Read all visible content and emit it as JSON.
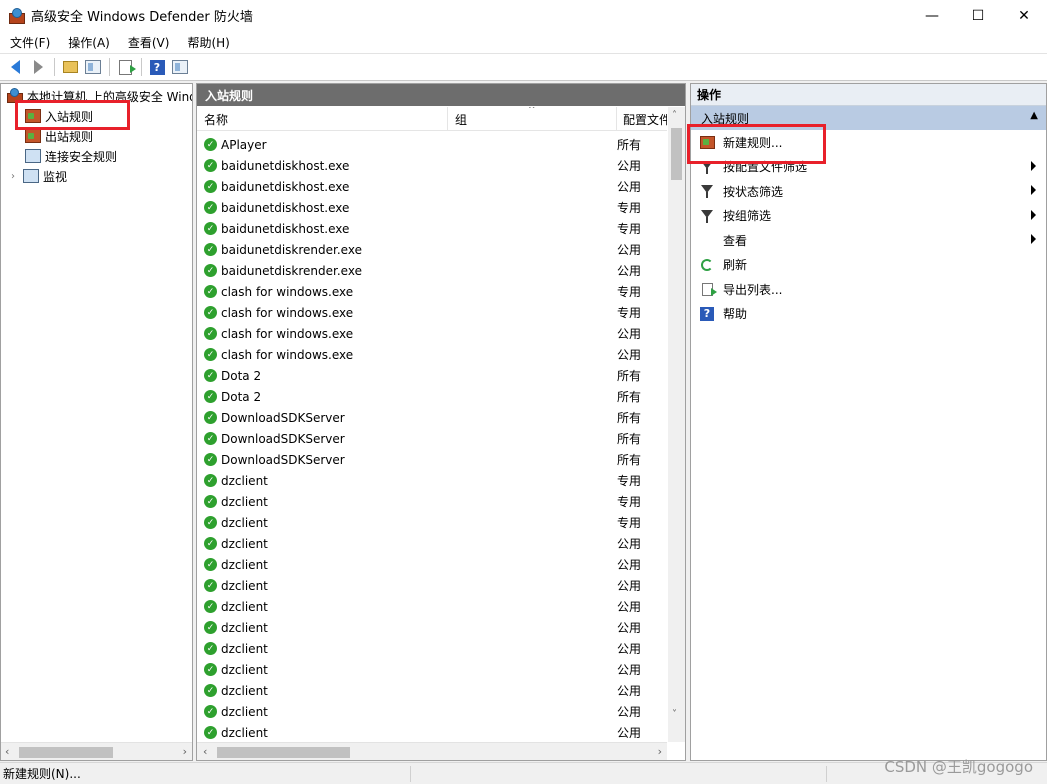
{
  "window": {
    "title": "高级安全 Windows Defender 防火墙",
    "minimize": "—",
    "maximize": "☐",
    "close": "✕"
  },
  "menu": [
    "文件(F)",
    "操作(A)",
    "查看(V)",
    "帮助(H)"
  ],
  "toolbar": {
    "icons": [
      "back-arrow-icon",
      "forward-arrow-icon",
      "up-folder-icon",
      "show-tree-icon",
      "export-icon",
      "help-icon",
      "show-action-pane-icon"
    ]
  },
  "tree": {
    "root": "本地计算机 上的高级安全 Windows Defender",
    "inbound": "入站规则",
    "outbound": "出站规则",
    "connection_security": "连接安全规则",
    "monitor": "监视"
  },
  "middle": {
    "header": "入站规则",
    "columns": {
      "name": "名称",
      "group": "组",
      "profile": "配置文件"
    },
    "rows": [
      {
        "name": "APlayer",
        "profile": "所有"
      },
      {
        "name": "baidunetdiskhost.exe",
        "profile": "公用"
      },
      {
        "name": "baidunetdiskhost.exe",
        "profile": "公用"
      },
      {
        "name": "baidunetdiskhost.exe",
        "profile": "专用"
      },
      {
        "name": "baidunetdiskhost.exe",
        "profile": "专用"
      },
      {
        "name": "baidunetdiskrender.exe",
        "profile": "公用"
      },
      {
        "name": "baidunetdiskrender.exe",
        "profile": "公用"
      },
      {
        "name": "clash for windows.exe",
        "profile": "专用"
      },
      {
        "name": "clash for windows.exe",
        "profile": "专用"
      },
      {
        "name": "clash for windows.exe",
        "profile": "公用"
      },
      {
        "name": "clash for windows.exe",
        "profile": "公用"
      },
      {
        "name": "Dota 2",
        "profile": "所有"
      },
      {
        "name": "Dota 2",
        "profile": "所有"
      },
      {
        "name": "DownloadSDKServer",
        "profile": "所有"
      },
      {
        "name": "DownloadSDKServer",
        "profile": "所有"
      },
      {
        "name": "DownloadSDKServer",
        "profile": "所有"
      },
      {
        "name": "dzclient",
        "profile": "专用"
      },
      {
        "name": "dzclient",
        "profile": "专用"
      },
      {
        "name": "dzclient",
        "profile": "专用"
      },
      {
        "name": "dzclient",
        "profile": "公用"
      },
      {
        "name": "dzclient",
        "profile": "公用"
      },
      {
        "name": "dzclient",
        "profile": "公用"
      },
      {
        "name": "dzclient",
        "profile": "公用"
      },
      {
        "name": "dzclient",
        "profile": "公用"
      },
      {
        "name": "dzclient",
        "profile": "公用"
      },
      {
        "name": "dzclient",
        "profile": "公用"
      },
      {
        "name": "dzclient",
        "profile": "公用"
      },
      {
        "name": "dzclient",
        "profile": "公用"
      },
      {
        "name": "dzclient",
        "profile": "公用"
      }
    ]
  },
  "actions": {
    "title": "操作",
    "section": "入站规则",
    "items": [
      {
        "label": "新建规则...",
        "icon": "new-rule-icon",
        "submenu": false
      },
      {
        "label": "按配置文件筛选",
        "icon": "filter-icon",
        "submenu": true
      },
      {
        "label": "按状态筛选",
        "icon": "filter-icon",
        "submenu": true
      },
      {
        "label": "按组筛选",
        "icon": "filter-icon",
        "submenu": true
      },
      {
        "label": "查看",
        "icon": "",
        "submenu": true
      },
      {
        "label": "刷新",
        "icon": "refresh-icon",
        "submenu": false
      },
      {
        "label": "导出列表...",
        "icon": "export-icon",
        "submenu": false
      },
      {
        "label": "帮助",
        "icon": "help-icon",
        "submenu": false
      }
    ]
  },
  "status": {
    "text": "新建规则(N)..."
  },
  "watermark": "CSDN @王凯gogogo",
  "colors": {
    "highlight": "#e8202a",
    "section": "#b9cbe3",
    "check": "#2ea02e"
  }
}
